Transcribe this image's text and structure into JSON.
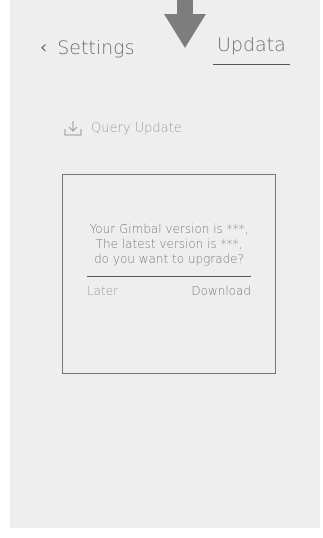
{
  "header": {
    "back_label": "Settings",
    "active_tab": "Updata"
  },
  "query": {
    "label": "Query Update",
    "icon": "download-icon"
  },
  "dialog": {
    "message_lines": [
      "Your Gimbal version is ***,",
      "The latest version is ***,",
      "do you want to upgrade?"
    ],
    "later_label": "Later",
    "download_label": "Download"
  },
  "colors": {
    "background": "#eeeeee",
    "text": "#7a7a7a",
    "pointer": "#7d7d7d"
  }
}
